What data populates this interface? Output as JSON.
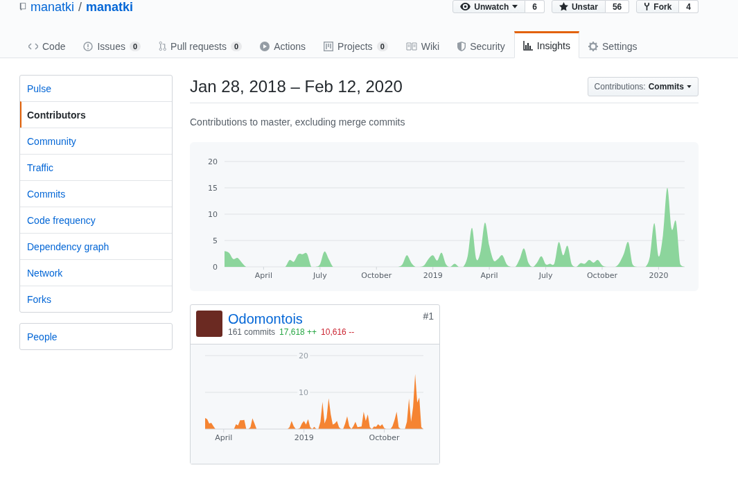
{
  "repo": {
    "owner": "manatki",
    "separator": "/",
    "name": "manatki"
  },
  "repo_actions": [
    {
      "label": "Unwatch",
      "count": "6",
      "kind": "watch"
    },
    {
      "label": "Unstar",
      "count": "56",
      "kind": "star"
    },
    {
      "label": "Fork",
      "count": "4",
      "kind": "fork"
    }
  ],
  "tabs": [
    {
      "label": "Code",
      "kind": "code",
      "selected": false
    },
    {
      "label": "Issues",
      "kind": "issues",
      "counter": "0",
      "selected": false
    },
    {
      "label": "Pull requests",
      "kind": "pulls",
      "counter": "0",
      "selected": false
    },
    {
      "label": "Actions",
      "kind": "actions",
      "selected": false
    },
    {
      "label": "Projects",
      "kind": "projects",
      "counter": "0",
      "selected": false
    },
    {
      "label": "Wiki",
      "kind": "wiki",
      "selected": false
    },
    {
      "label": "Security",
      "kind": "security",
      "selected": false
    },
    {
      "label": "Insights",
      "kind": "insights",
      "selected": true
    },
    {
      "label": "Settings",
      "kind": "settings",
      "selected": false
    }
  ],
  "sidebar": {
    "items": [
      {
        "label": "Pulse",
        "selected": false
      },
      {
        "label": "Contributors",
        "selected": true
      },
      {
        "label": "Community",
        "selected": false
      },
      {
        "label": "Traffic",
        "selected": false
      },
      {
        "label": "Commits",
        "selected": false
      },
      {
        "label": "Code frequency",
        "selected": false
      },
      {
        "label": "Dependency graph",
        "selected": false
      },
      {
        "label": "Network",
        "selected": false
      },
      {
        "label": "Forks",
        "selected": false
      }
    ],
    "people": {
      "label": "People",
      "selected": false
    }
  },
  "header": {
    "title": "Jan 28, 2018 – Feb 12, 2020",
    "dropdown_label": "Contributions:",
    "dropdown_value": "Commits"
  },
  "subtitle": "Contributions to master, excluding merge commits",
  "overview_chart": {
    "chart_data": {
      "type": "area",
      "categories": [
        null,
        null,
        null,
        null,
        null,
        null,
        null,
        null,
        null,
        "April",
        null,
        null,
        null,
        null,
        null,
        null,
        null,
        null,
        null,
        null,
        null,
        null,
        "July",
        null,
        null,
        null,
        null,
        null,
        null,
        null,
        null,
        null,
        null,
        null,
        null,
        "October",
        null,
        null,
        null,
        null,
        null,
        null,
        null,
        null,
        null,
        null,
        null,
        null,
        "2019",
        null,
        null,
        null,
        null,
        null,
        null,
        null,
        null,
        null,
        null,
        null,
        null,
        "April",
        null,
        null,
        null,
        null,
        null,
        null,
        null,
        null,
        null,
        null,
        null,
        null,
        "July",
        null,
        null,
        null,
        null,
        null,
        null,
        null,
        null,
        null,
        null,
        null,
        null,
        "October",
        null,
        null,
        null,
        null,
        null,
        null,
        null,
        null,
        null,
        null,
        null,
        null,
        "2020",
        null,
        null,
        null,
        null,
        null,
        null
      ],
      "series": [
        {
          "color": "#8cd59c",
          "values": [
            3,
            2.7,
            1.5,
            1.7,
            0.8,
            0,
            0,
            0,
            0,
            0,
            0,
            0,
            0,
            0,
            0,
            1.3,
            1,
            2.4,
            2.4,
            2.5,
            0,
            0,
            0.5,
            2.9,
            1.5,
            0,
            0,
            0,
            0,
            0,
            0,
            0,
            0,
            0,
            0,
            0,
            0,
            0,
            0,
            0,
            0,
            0.5,
            2.2,
            0.8,
            0,
            0,
            0.3,
            1.5,
            2.2,
            1.2,
            2.7,
            0.5,
            0,
            0.6,
            0,
            0,
            2,
            7.4,
            1.5,
            3,
            8.4,
            4,
            1.2,
            1.5,
            2.2,
            0.5,
            0,
            0,
            1.5,
            3.5,
            0.8,
            0,
            0.8,
            2,
            0.5,
            0.6,
            0.7,
            4.7,
            2.2,
            4,
            0.5,
            0,
            0.7,
            0.6,
            1.3,
            0.8,
            1.3,
            0.3,
            0,
            0,
            0,
            0.8,
            2.5,
            4.7,
            0.5,
            0,
            0,
            0,
            2,
            8.3,
            2,
            6,
            15,
            7.2,
            8.6,
            0.5,
            0
          ]
        }
      ],
      "ylim": [
        0,
        20
      ],
      "yticks": [
        0,
        5,
        10,
        15,
        20
      ],
      "grid": true
    }
  },
  "contributors": [
    {
      "name": "Odomontois",
      "rank": "#1",
      "commits": "161 commits",
      "additions": "17,618 ++",
      "deletions": "10,616 --",
      "chart_data": {
        "type": "area",
        "categories": [
          null,
          null,
          null,
          null,
          null,
          null,
          null,
          null,
          null,
          "April",
          null,
          null,
          null,
          null,
          null,
          null,
          null,
          null,
          null,
          null,
          null,
          null,
          null,
          null,
          null,
          null,
          null,
          null,
          null,
          null,
          null,
          null,
          null,
          null,
          null,
          null,
          null,
          null,
          null,
          null,
          null,
          null,
          null,
          null,
          null,
          null,
          null,
          null,
          "2019",
          null,
          null,
          null,
          null,
          null,
          null,
          null,
          null,
          null,
          null,
          null,
          null,
          null,
          null,
          null,
          null,
          null,
          null,
          null,
          null,
          null,
          null,
          null,
          null,
          null,
          null,
          null,
          null,
          null,
          null,
          null,
          null,
          null,
          null,
          null,
          null,
          null,
          null,
          "October",
          null,
          null,
          null,
          null,
          null,
          null,
          null,
          null,
          null,
          null,
          null,
          null,
          null,
          null,
          null,
          null,
          null,
          null,
          null
        ],
        "series": [
          {
            "color": "#f58432",
            "values": [
              3,
              2.7,
              1.5,
              1.7,
              0.8,
              0,
              0,
              0,
              0,
              0,
              0,
              0,
              0,
              0,
              0,
              1.3,
              1,
              2.4,
              2.4,
              2.5,
              0,
              0,
              0.5,
              2.9,
              1.5,
              0,
              0,
              0,
              0,
              0,
              0,
              0,
              0,
              0,
              0,
              0,
              0,
              0,
              0,
              0,
              0,
              0.5,
              2.2,
              0.8,
              0,
              0,
              0.3,
              1.5,
              2.2,
              1.2,
              2.7,
              0.5,
              0,
              0.6,
              0,
              0,
              2,
              7.4,
              1.5,
              3,
              8.4,
              4,
              1.2,
              1.5,
              2.2,
              0.5,
              0,
              0,
              1.5,
              3.5,
              0.8,
              0,
              0.8,
              2,
              0.5,
              0.6,
              0.7,
              4.7,
              2.2,
              4,
              0.5,
              0,
              0.7,
              0.6,
              1.3,
              0.8,
              1.3,
              0.3,
              0,
              0,
              0,
              0.8,
              2.5,
              4.7,
              0.5,
              0,
              0,
              0,
              2,
              8.3,
              2,
              6,
              15,
              7.2,
              8.6,
              0.5,
              0
            ]
          }
        ],
        "ylim": [
          0,
          20
        ],
        "yticks": [
          10,
          20
        ],
        "grid": true
      }
    }
  ]
}
